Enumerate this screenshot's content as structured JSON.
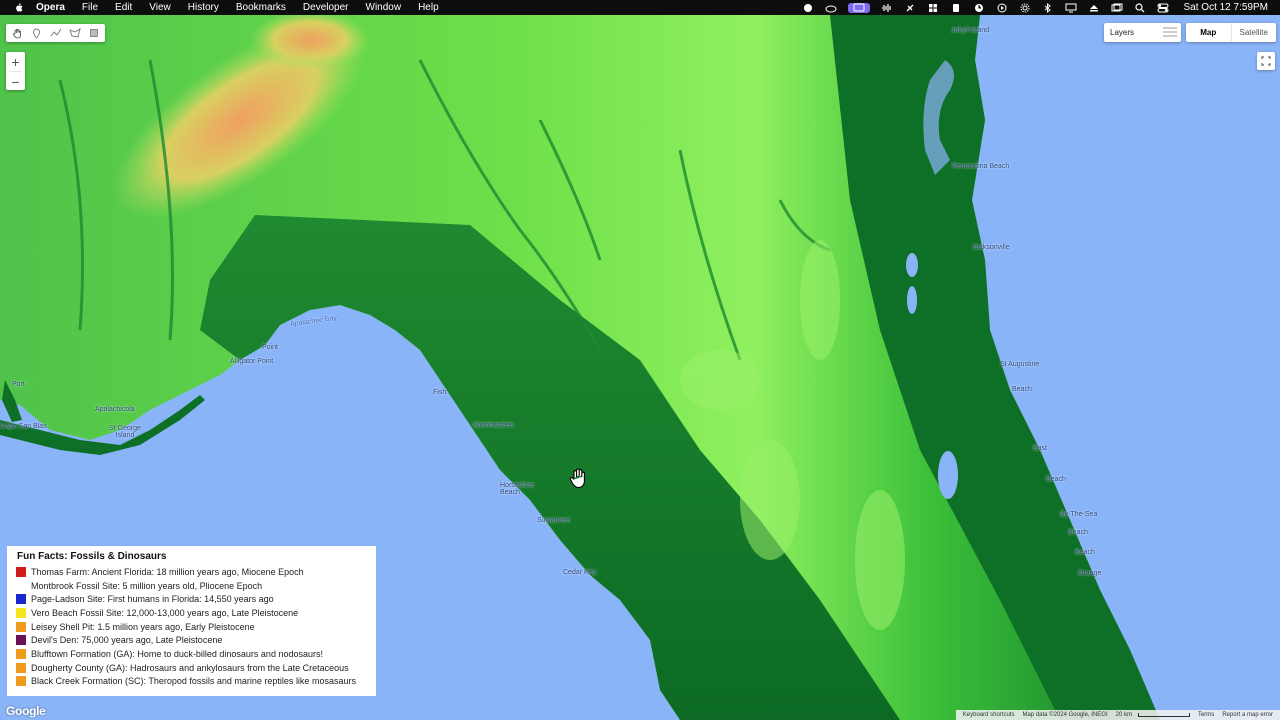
{
  "menubar": {
    "app_name": "Opera",
    "menus": [
      "File",
      "Edit",
      "View",
      "History",
      "Bookmarks",
      "Developer",
      "Window",
      "Help"
    ],
    "clock": "Sat Oct 12  7:59PM"
  },
  "map": {
    "labels": {
      "apalachee_bay": "Apalachee Bay",
      "jekyll_island": "Jekyll Island",
      "fernandina_beach": "Fernandina Beach",
      "jacksonville": "Jacksonville",
      "point": "Point",
      "alligator_point": "Alligator Point",
      "port": "Port",
      "apalachicola": "Apalachicola",
      "cape_san_blas": "Cape San Blas",
      "st_george_island": "St George Island",
      "fish": "Fish",
      "steinhatchee": "Steinhatchee",
      "horseshoe_beach": "Horseshoe Beach",
      "suwannee": "Suwannee",
      "cedar_key": "Cedar Key",
      "st_augustine": "St Augustine",
      "beach_1": "Beach",
      "east": "East",
      "beach_2": "Beach",
      "by_the_sea": "By-The-Sea",
      "beach_3": "Beach",
      "beach_4": "Beach",
      "orange": "Orange"
    },
    "layers_label": "Layers",
    "map_type_options": [
      "Map",
      "Satellite"
    ],
    "selected_map_type": "Map",
    "zoom_in": "+",
    "zoom_out": "−"
  },
  "legend": {
    "title": "Fun Facts: Fossils & Dinosaurs",
    "items": [
      {
        "color": "#d11a1a",
        "text": "Thomas Farm: Ancient Florida: 18 million years ago, Miocene Epoch"
      },
      {
        "color": "",
        "text": "Montbrook Fossil Site: 5 million years old, Pliocene Epoch"
      },
      {
        "color": "#1a27d1",
        "text": "Page-Ladson Site: First humans in Florida: 14,550 years ago"
      },
      {
        "color": "#f5e51b",
        "text": "Vero Beach Fossil Site: 12,000-13,000 years ago, Late Pleistocene"
      },
      {
        "color": "#f09a1e",
        "text": "Leisey Shell Pit: 1.5 million years ago, Early Pleistocene"
      },
      {
        "color": "#6b0f5a",
        "text": "Devil's Den: 75,000 years ago, Late Pleistocene"
      },
      {
        "color": "#f09a1e",
        "text": "Blufftown Formation (GA): Home to duck-billed dinosaurs and nodosaurs!"
      },
      {
        "color": "#f09a1e",
        "text": "Dougherty County (GA): Hadrosaurs and ankylosaurs from the Late Cretaceous"
      },
      {
        "color": "#f09a1e",
        "text": "Black Creek Formation (SC): Theropod fossils and marine reptiles like mosasaurs"
      }
    ]
  },
  "footer": {
    "google": "Google",
    "keyboard_shortcuts": "Keyboard shortcuts",
    "map_data": "Map data ©2024 Google, INEGI",
    "scale": "20 km",
    "terms": "Terms",
    "report": "Report a map error"
  }
}
